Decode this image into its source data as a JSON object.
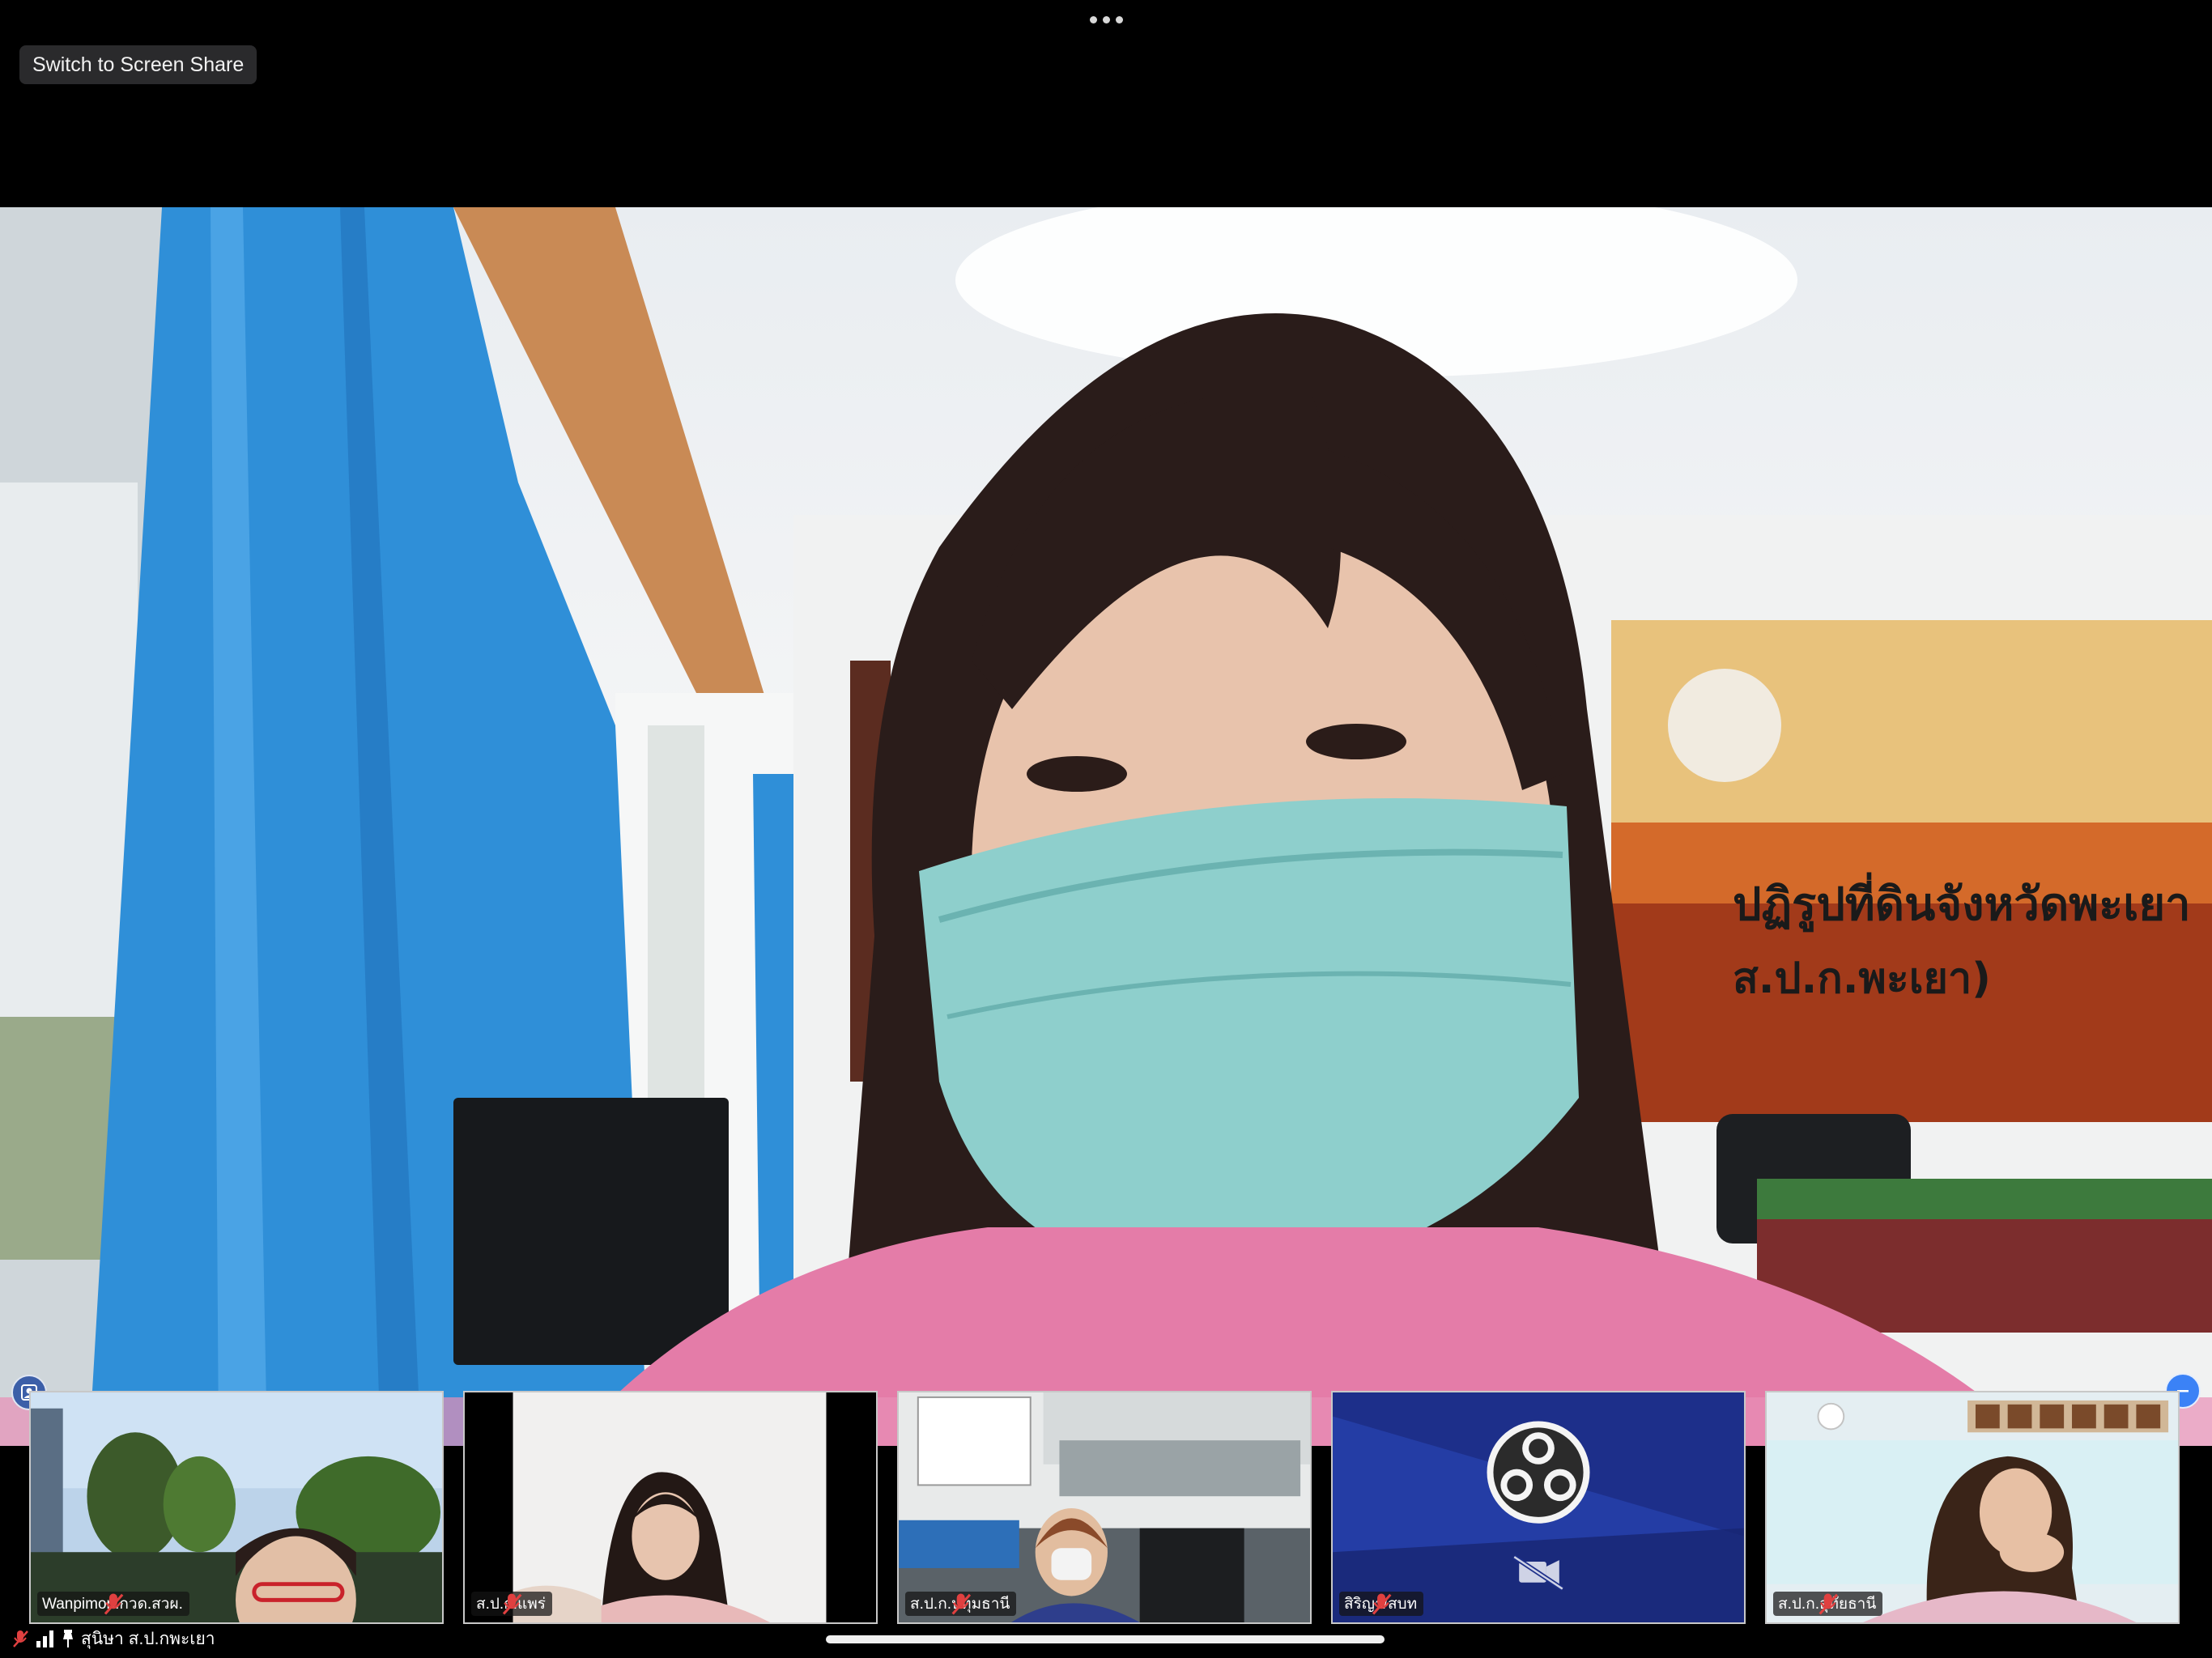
{
  "top_bar": {
    "more_icon": "more-horizontal-icon",
    "switch_label": "Switch to Screen Share"
  },
  "main_video": {
    "banner_text_line1": "ปฏิรูปที่ดินจังหวัดพะเยา",
    "banner_text_line2": "ส.ป.ก.พะเยา)"
  },
  "participants": [
    {
      "name": "Wanpimon.กวด.สวผ.",
      "mic": "muted"
    },
    {
      "name": "ส.ป.ก.แพร่",
      "mic": "muted"
    },
    {
      "name": "ส.ป.ก.ปทุมธานี",
      "mic": "muted"
    },
    {
      "name": "สิริญา/สบท",
      "mic": "muted",
      "video": "off"
    },
    {
      "name": "ส.ป.ก.อุทัยธานี",
      "mic": "muted"
    }
  ],
  "self_view": {
    "name": "สุนิษา ส.ป.กพะเยา",
    "icons": [
      "mic-muted-icon",
      "signal-icon",
      "pin-icon"
    ]
  },
  "colors": {
    "curtain_blue": "#2f8fd8",
    "obs_tile_bg": "#1d2f8a",
    "mute_red": "#e04040"
  }
}
